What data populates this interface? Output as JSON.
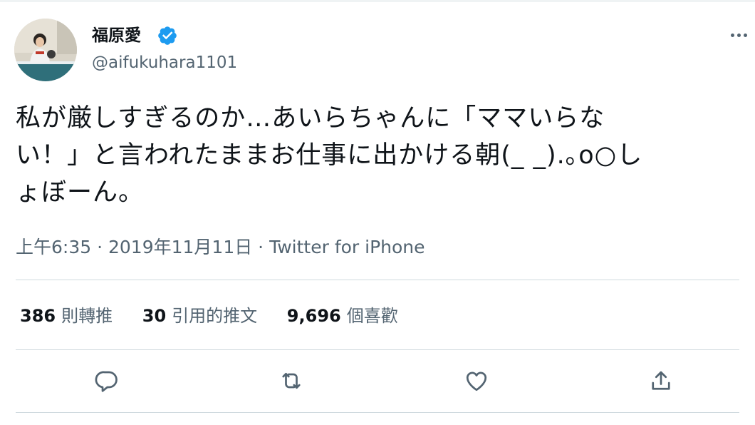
{
  "tweet": {
    "author": {
      "display_name": "福原愛",
      "handle": "@aifukuhara1101",
      "verified": true,
      "avatar_icon": "avatar-photo"
    },
    "text": "私が厳しすぎるのか…あいらちゃんに「ママいらな\nい！」と言われたままお仕事に出かける朝(_ _).｡o○し\nょぼーん。",
    "time": "上午6:35",
    "separator": " · ",
    "date": "2019年11月11日",
    "source": "Twitter for iPhone",
    "stats": [
      {
        "count": "386",
        "label": "則轉推"
      },
      {
        "count": "30",
        "label": "引用的推文"
      },
      {
        "count": "9,696",
        "label": "個喜歡"
      }
    ],
    "actions": [
      "reply-icon",
      "retweet-icon",
      "like-icon",
      "share-icon"
    ]
  },
  "colors": {
    "text": "#0f1419",
    "secondary": "#536471",
    "verified": "#1d9bf0",
    "divider": "#cfd9de"
  }
}
